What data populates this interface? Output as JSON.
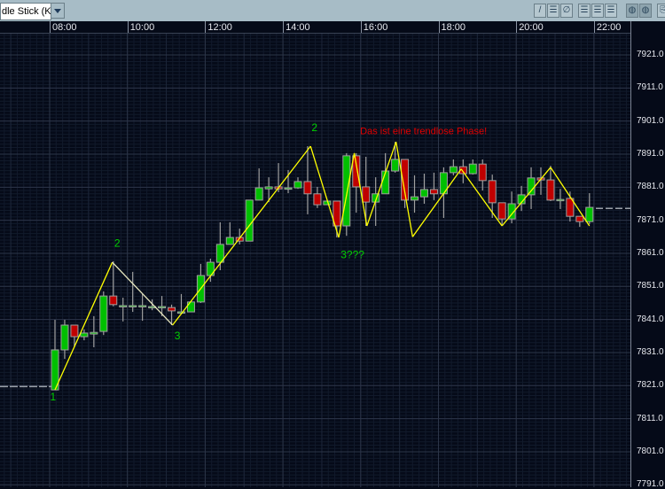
{
  "toolbar": {
    "chart_type_select": "dle Stick (Ke",
    "buttons": [
      {
        "name": "draw-line-icon",
        "glyph": "/"
      },
      {
        "name": "horizontal-line-icon",
        "glyph": "☰"
      },
      {
        "name": "no-drawing-icon",
        "glyph": "∅"
      },
      {
        "name": "grid-1-icon",
        "glyph": "☰"
      },
      {
        "name": "grid-2-icon",
        "glyph": "☰"
      },
      {
        "name": "grid-3-icon",
        "glyph": "☰"
      },
      {
        "name": "globe-icon",
        "glyph": "◍"
      },
      {
        "name": "pattern-icon",
        "glyph": "◍"
      },
      {
        "name": "export-icon",
        "glyph": "⎘"
      }
    ]
  },
  "colors": {
    "up": "#00c000",
    "down": "#c00000",
    "border": "#a0a0a0",
    "zigzag": "#ffff00",
    "annotation_green": "#00d000",
    "annotation_red": "#e00000"
  },
  "chart_data": {
    "type": "candlestick",
    "interval_minutes": 15,
    "time_ticks": [
      "08:00",
      "10:00",
      "12:00",
      "14:00",
      "16:00",
      "18:00",
      "20:00",
      "22:00"
    ],
    "price_ticks": [
      "7921.0",
      "7911.0",
      "7901.0",
      "7891.0",
      "7881.0",
      "7871.0",
      "7861.0",
      "7851.0",
      "7841.0",
      "7831.0",
      "7821.0",
      "7811.0",
      "7801.0",
      "7791.0"
    ],
    "ylim": [
      7790,
      7929
    ],
    "first_candle_offset": 0.15,
    "candles": [
      [
        7819.7,
        7840.9,
        7819.7,
        7831.8
      ],
      [
        7831.8,
        7840.9,
        7829.1,
        7839.3
      ],
      [
        7839.3,
        7839.3,
        7832.6,
        7835.8
      ],
      [
        7835.8,
        7838,
        7834.7,
        7836.9
      ],
      [
        7836.6,
        7842,
        7832.6,
        7837.1
      ],
      [
        7837.4,
        7849.5,
        7836.3,
        7848.1
      ],
      [
        7848.1,
        7858.6,
        7845,
        7845.5
      ],
      [
        7845.2,
        7847.6,
        7840.4,
        7845.2
      ],
      [
        7845.2,
        7855.4,
        7843.3,
        7845.2
      ],
      [
        7845.2,
        7848.7,
        7840.6,
        7845.2
      ],
      [
        7844.9,
        7847.1,
        7843.8,
        7844.9
      ],
      [
        7844.9,
        7848.1,
        7842,
        7844.9
      ],
      [
        7844.6,
        7845.5,
        7839.3,
        7843.6
      ],
      [
        7843.3,
        7848.7,
        7842.5,
        7843.3
      ],
      [
        7843.3,
        7846.3,
        7843.3,
        7846.3
      ],
      [
        7846.3,
        7857.8,
        7846,
        7854.3
      ],
      [
        7854.3,
        7859.4,
        7852.4,
        7858.3
      ],
      [
        7858.3,
        7870.4,
        7855.9,
        7863.7
      ],
      [
        7863.7,
        7870.4,
        7863.7,
        7865.8
      ],
      [
        7865.8,
        7868.5,
        7863.7,
        7864.7
      ],
      [
        7864.7,
        7877.1,
        7864.7,
        7877.1
      ],
      [
        7877.1,
        7886.7,
        7877.1,
        7880.8
      ],
      [
        7880.5,
        7884,
        7876.5,
        7881.1
      ],
      [
        7881.1,
        7888.3,
        7879.5,
        7880.5
      ],
      [
        7880.8,
        7886.2,
        7879.2,
        7880.8
      ],
      [
        7880.8,
        7884,
        7880.5,
        7882.7
      ],
      [
        7882.7,
        7893.4,
        7872.8,
        7879
      ],
      [
        7879,
        7881.1,
        7874.7,
        7875.7
      ],
      [
        7875.7,
        7876.8,
        7875.7,
        7876.8
      ],
      [
        7876.8,
        7876.8,
        7865.8,
        7869.3
      ],
      [
        7869.3,
        7891.3,
        7866.3,
        7890.5
      ],
      [
        7890.5,
        7891.3,
        7873.3,
        7881.1
      ],
      [
        7881.1,
        7890.2,
        7869.3,
        7876.5
      ],
      [
        7876.5,
        7884,
        7869.3,
        7879
      ],
      [
        7879,
        7891.3,
        7879,
        7885.9
      ],
      [
        7885.9,
        7894.7,
        7885.4,
        7889.4
      ],
      [
        7889.4,
        7889.4,
        7874.7,
        7877.1
      ],
      [
        7877.1,
        7884.6,
        7873.3,
        7878.1
      ],
      [
        7878.1,
        7885.1,
        7876,
        7880.3
      ],
      [
        7880.3,
        7885.4,
        7877.1,
        7879
      ],
      [
        7879,
        7887,
        7871.7,
        7885.4
      ],
      [
        7885.4,
        7889.4,
        7884.6,
        7887.2
      ],
      [
        7887.2,
        7889.4,
        7882.2,
        7885.1
      ],
      [
        7885.1,
        7889.4,
        7884.8,
        7888
      ],
      [
        7888,
        7889.4,
        7880,
        7883
      ],
      [
        7883,
        7884.8,
        7871.7,
        7876.3
      ],
      [
        7876.3,
        7876.3,
        7869.3,
        7871.4
      ],
      [
        7871.4,
        7879.7,
        7870.1,
        7876
      ],
      [
        7876,
        7881.4,
        7873.8,
        7878.7
      ],
      [
        7878.7,
        7887,
        7874.4,
        7883.8
      ],
      [
        7883.8,
        7887,
        7878.7,
        7883.2
      ],
      [
        7883.2,
        7887.5,
        7876.8,
        7877.1
      ],
      [
        7877.3,
        7880.5,
        7874.4,
        7877.3
      ],
      [
        7877.6,
        7879.7,
        7870.6,
        7872.2
      ],
      [
        7872.2,
        7872.2,
        7869,
        7870.6
      ],
      [
        7870.6,
        7879.2,
        7869.8,
        7874.9
      ]
    ],
    "zigzag": [
      {
        "i": 0,
        "p": 7819.7,
        "c": "#ffff00"
      },
      {
        "i": 5.9,
        "p": 7858.3,
        "c": "#e8e8c0"
      },
      {
        "i": 12.1,
        "p": 7839.3,
        "c": "#ffff00"
      },
      {
        "i": 26.3,
        "p": 7893.4,
        "c": "#ffff00"
      },
      {
        "i": 29.2,
        "p": 7865.8,
        "c": "#ffff00"
      },
      {
        "i": 30.8,
        "p": 7891.3,
        "c": "#ffff00"
      },
      {
        "i": 32.1,
        "p": 7869.3,
        "c": "#ffff00"
      },
      {
        "i": 35.1,
        "p": 7894.7,
        "c": "#ffff00"
      },
      {
        "i": 36.8,
        "p": 7866,
        "c": "#ffff00"
      },
      {
        "i": 41.8,
        "p": 7886.5,
        "c": "#ffff00"
      },
      {
        "i": 46,
        "p": 7869.3,
        "c": "#ffff00"
      },
      {
        "i": 51,
        "p": 7887,
        "c": "#ffff00"
      },
      {
        "i": 55,
        "p": 7869.3,
        "c": "#ffff00"
      }
    ],
    "annotations": [
      {
        "text": "1",
        "i": -0.5,
        "p": 7816.5,
        "color": "green"
      },
      {
        "text": "2",
        "i": 6.1,
        "p": 7863,
        "color": "green"
      },
      {
        "text": "3",
        "i": 12.3,
        "p": 7835,
        "color": "green"
      },
      {
        "text": "2",
        "i": 26.4,
        "p": 7898,
        "color": "green"
      },
      {
        "text": "3???",
        "i": 29.4,
        "p": 7859.5,
        "color": "green"
      },
      {
        "text": "Das ist eine trendlose Phase!",
        "i": 31.4,
        "p": 7897,
        "color": "red"
      }
    ],
    "reference_line_left": 7820.7,
    "current_price_line": 7874.6
  }
}
